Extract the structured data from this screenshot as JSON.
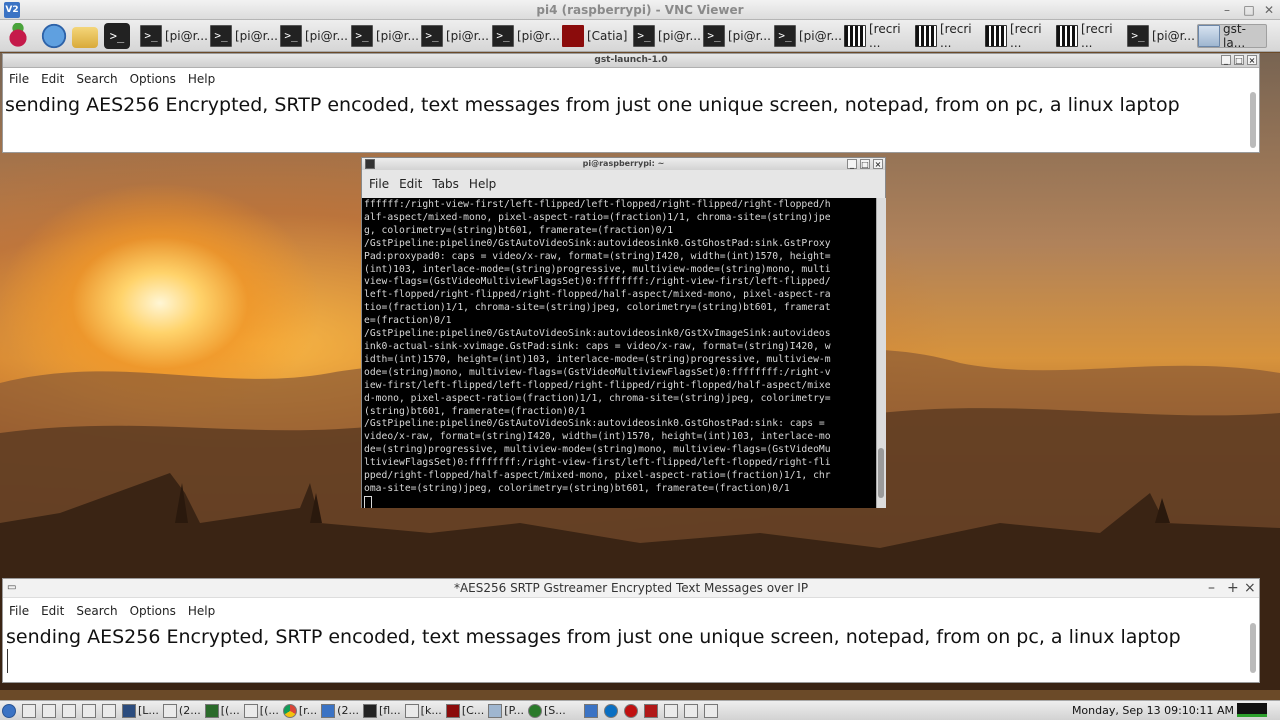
{
  "vnc": {
    "title": "pi4 (raspberrypi) - VNC Viewer",
    "logo": "V2"
  },
  "pi_panel": {
    "tasks": [
      {
        "icon": "terminal-icon",
        "label": ""
      },
      {
        "icon": "terminal-icon",
        "label": "[pi@r..."
      },
      {
        "icon": "terminal-icon",
        "label": "[pi@r..."
      },
      {
        "icon": "terminal-icon",
        "label": "[pi@r..."
      },
      {
        "icon": "terminal-icon",
        "label": "[pi@r..."
      },
      {
        "icon": "terminal-icon",
        "label": "[pi@r..."
      },
      {
        "icon": "terminal-icon",
        "label": "[pi@r..."
      },
      {
        "icon": "catia-icon",
        "label": "[Catia]"
      },
      {
        "icon": "terminal-icon",
        "label": "[pi@r..."
      },
      {
        "icon": "terminal-icon",
        "label": "[pi@r..."
      },
      {
        "icon": "terminal-icon",
        "label": "[pi@r..."
      },
      {
        "icon": "grid-icon",
        "label": "[recri ..."
      },
      {
        "icon": "grid-icon",
        "label": "[recri ..."
      },
      {
        "icon": "grid-icon",
        "label": "[recri ..."
      },
      {
        "icon": "grid-icon",
        "label": "[recri ..."
      },
      {
        "icon": "terminal-icon",
        "label": "[pi@r..."
      },
      {
        "icon": "window-icon",
        "label": "gst-la..."
      }
    ]
  },
  "gst_window": {
    "title": "gst-launch-1.0",
    "menu": [
      "File",
      "Edit",
      "Search",
      "Options",
      "Help"
    ],
    "text": "sending AES256 Encrypted, SRTP encoded, text messages from just one unique screen,  notepad, from on pc, a linux laptop"
  },
  "terminal": {
    "title": "pi@raspberrypi: ~",
    "menu": [
      "File",
      "Edit",
      "Tabs",
      "Help"
    ],
    "lines": [
      "ffffff:/right-view-first/left-flipped/left-flopped/right-flipped/right-flopped/h",
      "alf-aspect/mixed-mono, pixel-aspect-ratio=(fraction)1/1, chroma-site=(string)jpe",
      "g, colorimetry=(string)bt601, framerate=(fraction)0/1",
      "/GstPipeline:pipeline0/GstAutoVideoSink:autovideosink0.GstGhostPad:sink.GstProxy",
      "Pad:proxypad0: caps = video/x-raw, format=(string)I420, width=(int)1570, height=",
      "(int)103, interlace-mode=(string)progressive, multiview-mode=(string)mono, multi",
      "view-flags=(GstVideoMultiviewFlagsSet)0:ffffffff:/right-view-first/left-flipped/",
      "left-flopped/right-flipped/right-flopped/half-aspect/mixed-mono, pixel-aspect-ra",
      "tio=(fraction)1/1, chroma-site=(string)jpeg, colorimetry=(string)bt601, framerat",
      "e=(fraction)0/1",
      "/GstPipeline:pipeline0/GstAutoVideoSink:autovideosink0/GstXvImageSink:autovideos",
      "ink0-actual-sink-xvimage.GstPad:sink: caps = video/x-raw, format=(string)I420, w",
      "idth=(int)1570, height=(int)103, interlace-mode=(string)progressive, multiview-m",
      "ode=(string)mono, multiview-flags=(GstVideoMultiviewFlagsSet)0:ffffffff:/right-v",
      "iew-first/left-flipped/left-flopped/right-flipped/right-flopped/half-aspect/mixe",
      "d-mono, pixel-aspect-ratio=(fraction)1/1, chroma-site=(string)jpeg, colorimetry=",
      "(string)bt601, framerate=(fraction)0/1",
      "/GstPipeline:pipeline0/GstAutoVideoSink:autovideosink0.GstGhostPad:sink: caps =",
      "video/x-raw, format=(string)I420, width=(int)1570, height=(int)103, interlace-mo",
      "de=(string)progressive, multiview-mode=(string)mono, multiview-flags=(GstVideoMu",
      "ltiviewFlagsSet)0:ffffffff:/right-view-first/left-flipped/left-flopped/right-fli",
      "pped/right-flopped/half-aspect/mixed-mono, pixel-aspect-ratio=(fraction)1/1, chr",
      "oma-site=(string)jpeg, colorimetry=(string)bt601, framerate=(fraction)0/1"
    ]
  },
  "bottom_editor": {
    "title": "*AES256 SRTP Gstreamer Encrypted Text Messages over IP",
    "menu": [
      "File",
      "Edit",
      "Search",
      "Options",
      "Help"
    ],
    "text": "sending AES256 Encrypted, SRTP encoded, text messages from just one unique screen,  notepad, from on pc, a linux laptop"
  },
  "taskbar": {
    "items": [
      "[L...",
      "(2...",
      "[(...",
      "[(...",
      "[r...",
      "(2...",
      "[fl...",
      "[k...",
      "[C...",
      "[P...",
      "[S..."
    ],
    "clock": "Monday, Sep 13 09:10:11 AM"
  }
}
